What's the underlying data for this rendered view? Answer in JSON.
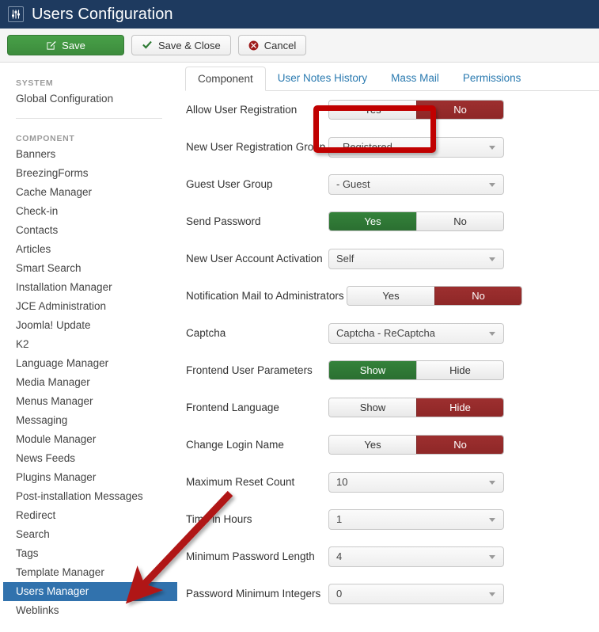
{
  "header": {
    "title": "Users Configuration",
    "icon": "sliders-icon",
    "background": "#1e3a5f"
  },
  "toolbar": {
    "buttons": [
      {
        "label": "Save",
        "icon": "edit-pencil-icon",
        "style": "primary",
        "color": "#3d8c3d"
      },
      {
        "label": "Save & Close",
        "icon": "check-icon",
        "style": "default"
      },
      {
        "label": "Cancel",
        "icon": "cancel-circle-icon",
        "style": "default"
      }
    ]
  },
  "sidebar": {
    "groups": [
      {
        "heading": "SYSTEM",
        "items": [
          {
            "label": "Global Configuration",
            "active": false
          }
        ]
      },
      {
        "heading": "COMPONENT",
        "items": [
          {
            "label": "Banners",
            "active": false
          },
          {
            "label": "BreezingForms",
            "active": false
          },
          {
            "label": "Cache Manager",
            "active": false
          },
          {
            "label": "Check-in",
            "active": false
          },
          {
            "label": "Contacts",
            "active": false
          },
          {
            "label": "Articles",
            "active": false
          },
          {
            "label": "Smart Search",
            "active": false
          },
          {
            "label": "Installation Manager",
            "active": false
          },
          {
            "label": "JCE Administration",
            "active": false
          },
          {
            "label": "Joomla! Update",
            "active": false
          },
          {
            "label": "K2",
            "active": false
          },
          {
            "label": "Language Manager",
            "active": false
          },
          {
            "label": "Media Manager",
            "active": false
          },
          {
            "label": "Menus Manager",
            "active": false
          },
          {
            "label": "Messaging",
            "active": false
          },
          {
            "label": "Module Manager",
            "active": false
          },
          {
            "label": "News Feeds",
            "active": false
          },
          {
            "label": "Plugins Manager",
            "active": false
          },
          {
            "label": "Post-installation Messages",
            "active": false
          },
          {
            "label": "Redirect",
            "active": false
          },
          {
            "label": "Search",
            "active": false
          },
          {
            "label": "Tags",
            "active": false
          },
          {
            "label": "Template Manager",
            "active": false
          },
          {
            "label": "Users Manager",
            "active": true
          },
          {
            "label": "Weblinks",
            "active": false
          }
        ]
      }
    ],
    "active_highlight_color": "#3172ad"
  },
  "tabs": [
    {
      "label": "Component",
      "active": true
    },
    {
      "label": "User Notes History",
      "active": false
    },
    {
      "label": "Mass Mail",
      "active": false
    },
    {
      "label": "Permissions",
      "active": false
    }
  ],
  "form": {
    "fields": [
      {
        "label": "Allow User Registration",
        "type": "toggle",
        "options": [
          "Yes",
          "No"
        ],
        "selected": "Yes",
        "selected_state": "neutral",
        "highlighted": true,
        "wide": false
      },
      {
        "label": "New User Registration Group",
        "type": "select",
        "value": "- Registered",
        "wide": false
      },
      {
        "label": "Guest User Group",
        "type": "select",
        "value": "- Guest",
        "wide": false
      },
      {
        "label": "Send Password",
        "type": "toggle",
        "options": [
          "Yes",
          "No"
        ],
        "selected": "Yes",
        "selected_state": "yes",
        "wide": false
      },
      {
        "label": "New User Account Activation",
        "type": "select",
        "value": "Self",
        "wide": false
      },
      {
        "label": "Notification Mail to Administrators",
        "type": "toggle",
        "options": [
          "Yes",
          "No"
        ],
        "selected": "No",
        "selected_state": "no",
        "wide": true
      },
      {
        "label": "Captcha",
        "type": "select",
        "value": "Captcha - ReCaptcha",
        "wide": false
      },
      {
        "label": "Frontend User Parameters",
        "type": "toggle",
        "options": [
          "Show",
          "Hide"
        ],
        "selected": "Show",
        "selected_state": "yes",
        "wide": false
      },
      {
        "label": "Frontend Language",
        "type": "toggle",
        "options": [
          "Show",
          "Hide"
        ],
        "selected": "Hide",
        "selected_state": "no",
        "wide": false
      },
      {
        "label": "Change Login Name",
        "type": "toggle",
        "options": [
          "Yes",
          "No"
        ],
        "selected": "No",
        "selected_state": "no",
        "wide": false
      },
      {
        "label": "Maximum Reset Count",
        "type": "select",
        "value": "10",
        "wide": false
      },
      {
        "label": "Time in Hours",
        "type": "select",
        "value": "1",
        "wide": false
      },
      {
        "label": "Minimum Password Length",
        "type": "select",
        "value": "4",
        "wide": false
      },
      {
        "label": "Password Minimum Integers",
        "type": "select",
        "value": "0",
        "wide": false
      }
    ]
  },
  "annotations": {
    "highlight_color": "#c00000",
    "arrow_color": "#b01818",
    "highlight_target": "Allow User Registration",
    "arrow_target": "Users Manager"
  }
}
